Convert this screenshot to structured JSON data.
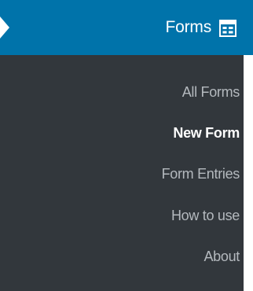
{
  "header": {
    "title": "Forms",
    "icon": "form-table-icon",
    "accent_color": "#0073aa"
  },
  "submenu": {
    "background_color": "#32373c",
    "items": [
      {
        "label": "All Forms",
        "current": false
      },
      {
        "label": "New Form",
        "current": true
      },
      {
        "label": "Form Entries",
        "current": false
      },
      {
        "label": "How to use",
        "current": false
      },
      {
        "label": "About",
        "current": false
      }
    ]
  }
}
